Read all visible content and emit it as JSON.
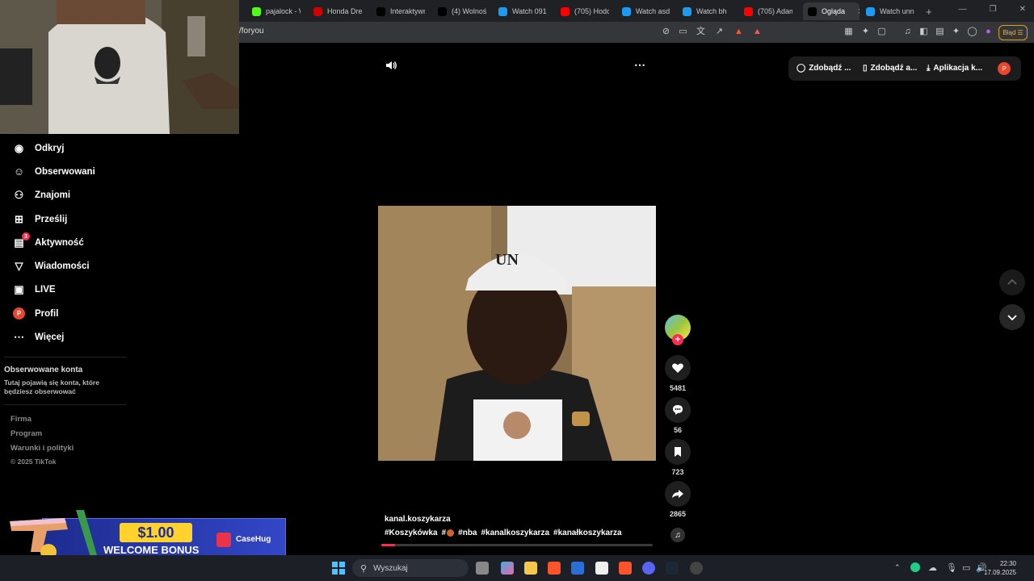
{
  "browser": {
    "tabs": [
      {
        "label": "pajalock - W",
        "icon": "kick-icon",
        "color": "#53fc18"
      },
      {
        "label": "Honda Dre",
        "icon": "honda-icon",
        "color": "#cc0000"
      },
      {
        "label": "Interaktywn",
        "icon": "tiktok-icon",
        "color": "#000000"
      },
      {
        "label": "(4) Wolność",
        "icon": "x-icon",
        "color": "#000000"
      },
      {
        "label": "Watch 0918",
        "icon": "watch-icon",
        "color": "#1d9bf0"
      },
      {
        "label": "(705) Hodo",
        "icon": "youtube-icon",
        "color": "#ff0000"
      },
      {
        "label": "Watch asd",
        "icon": "watch-icon",
        "color": "#1d9bf0"
      },
      {
        "label": "Watch bh",
        "icon": "watch-icon",
        "color": "#1d9bf0"
      },
      {
        "label": "(705) Adam",
        "icon": "youtube-icon",
        "color": "#ff0000"
      },
      {
        "label": "Ogląda",
        "icon": "tiktok-icon",
        "color": "#000000",
        "active": true
      },
      {
        "label": "Watch unn",
        "icon": "watch-icon",
        "color": "#1d9bf0"
      }
    ],
    "url": "/foryou",
    "error_button": "Błąd"
  },
  "sidebar": {
    "items": [
      {
        "label": "Odkryj",
        "icon": "compass-icon"
      },
      {
        "label": "Obserwowani",
        "icon": "following-icon"
      },
      {
        "label": "Znajomi",
        "icon": "friends-icon"
      },
      {
        "label": "Prześlij",
        "icon": "upload-icon"
      },
      {
        "label": "Aktywność",
        "icon": "activity-icon",
        "badge": "3"
      },
      {
        "label": "Wiadomości",
        "icon": "messages-icon"
      },
      {
        "label": "LIVE",
        "icon": "live-icon"
      },
      {
        "label": "Profil",
        "icon": "profile-icon",
        "avatar": "P"
      },
      {
        "label": "Więcej",
        "icon": "more-icon"
      }
    ],
    "followed_heading": "Obserwowane konta",
    "followed_desc": "Tutaj pojawią się konta, które będziesz obserwować",
    "footer": [
      "Firma",
      "Program",
      "Warunki i polityki",
      "© 2025 TikTok"
    ]
  },
  "topbar": {
    "btn1": "Zdobądź ...",
    "btn2": "Zdobądź a...",
    "btn3": "Aplikacja k...",
    "avatar": "P"
  },
  "video": {
    "cap_text": "UN",
    "author": "kanal.koszykarza",
    "tags": [
      "#Koszykówka",
      "#",
      "#nba",
      "#kanalkoszykarza",
      "#kanałkoszykarza"
    ],
    "progress": 0.05,
    "likes": "5481",
    "comments": "56",
    "saves": "723",
    "shares": "2865"
  },
  "ad": {
    "amount": "$1.00",
    "text": "WELCOME BONUS",
    "brand": "CaseHug"
  },
  "taskbar": {
    "search_placeholder": "Wyszukaj",
    "time": "22:30",
    "date": "17.09.2025"
  }
}
